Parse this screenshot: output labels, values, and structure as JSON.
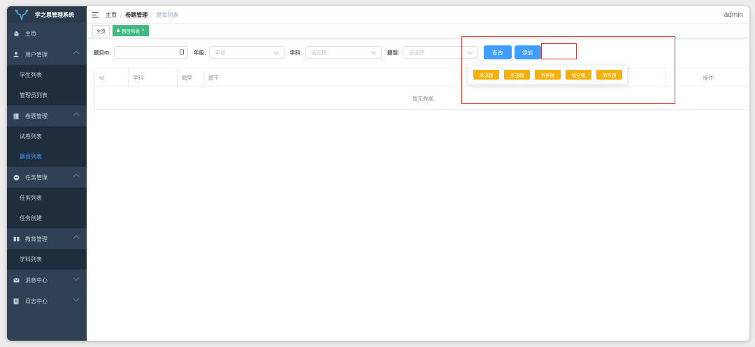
{
  "app": {
    "title": "学之思管理系统"
  },
  "sidebar": {
    "home": "主页",
    "user_mgmt": {
      "label": "用户管理",
      "items": [
        "学生列表",
        "管理员列表"
      ]
    },
    "exam_mgmt": {
      "label": "卷题管理",
      "items": [
        "试卷列表",
        "题目列表"
      ]
    },
    "task_mgmt": {
      "label": "任务管理",
      "items": [
        "任务列表",
        "任务创建"
      ]
    },
    "edu_mgmt": {
      "label": "教育管理",
      "items": [
        "学科列表"
      ]
    },
    "msg_center": "消息中心",
    "log_center": "日志中心"
  },
  "header": {
    "breadcrumb": [
      "主页",
      "卷题管理",
      "题目列表"
    ],
    "user": "admin"
  },
  "tags": {
    "home": "主页",
    "current": "题目列表"
  },
  "filters": {
    "id_label": "题目ID:",
    "id_value": "",
    "grade_label": "年级:",
    "grade_placeholder": "年级",
    "subject_label": "学科:",
    "subject_placeholder": "请选择",
    "type_label": "题型:",
    "type_placeholder": "请选择",
    "query_button": "查询",
    "add_button": "添加"
  },
  "table": {
    "columns": [
      "Id",
      "学科",
      "题型",
      "题干",
      "操作"
    ],
    "empty_text": "暂无数据"
  },
  "add_menu": [
    "单选题",
    "多选题",
    "判断题",
    "填空题",
    "简答题"
  ],
  "colors": {
    "sidebar_bg": "#304156",
    "accent": "#409eff",
    "tag_active": "#42b983",
    "add_option": "#f5b10a",
    "highlight": "#e0332e"
  }
}
